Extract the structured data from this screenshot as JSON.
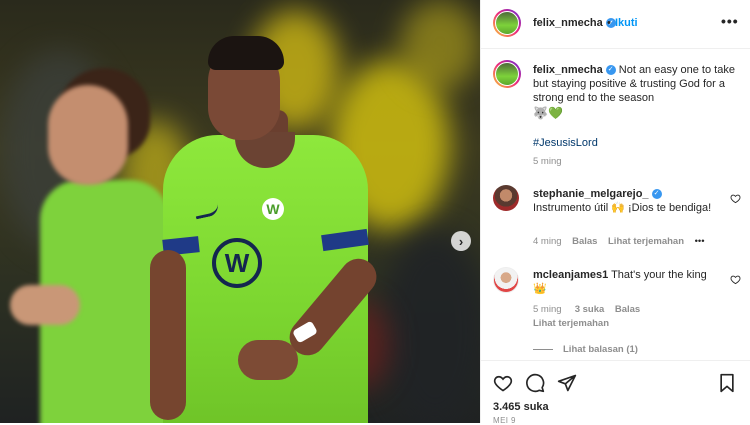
{
  "post": {
    "username": "felix_nmecha",
    "dot": "•",
    "follow_label": "Ikuti",
    "more_label": "•••",
    "caption": "Not an easy one to take but staying positive & trusting God for a strong end to the season",
    "caption_emojis": "🐺💚",
    "hashtag": "#JesusisLord",
    "time": "5 ming"
  },
  "comments": [
    {
      "username": "stephanie_melgarejo_",
      "text": "Instrumento útil 🙌 ¡Dios te bendiga!",
      "time": "4 ming",
      "reply_label": "Balas",
      "translate_label": "Lihat terjemahan",
      "more_label": "•••"
    },
    {
      "username": "mcleanjames1",
      "text": "That's your the king 👑",
      "time": "5 ming",
      "likes": "3 suka",
      "reply_label": "Balas",
      "translate_label": "Lihat terjemahan",
      "view_replies_label": "Lihat balasan (1)"
    }
  ],
  "footer": {
    "likes": "3.465 suka",
    "date": "MEI 9"
  },
  "media": {
    "next_label": "›",
    "jersey_logo": "W",
    "badge": "W"
  },
  "icons": {
    "verified": "verified-badge-icon",
    "like": "heart-icon",
    "comment": "comment-icon",
    "share": "send-icon",
    "save": "bookmark-icon"
  },
  "colors": {
    "link": "#0095f6",
    "verified": "#3897f0",
    "jersey": "#86e03a"
  }
}
